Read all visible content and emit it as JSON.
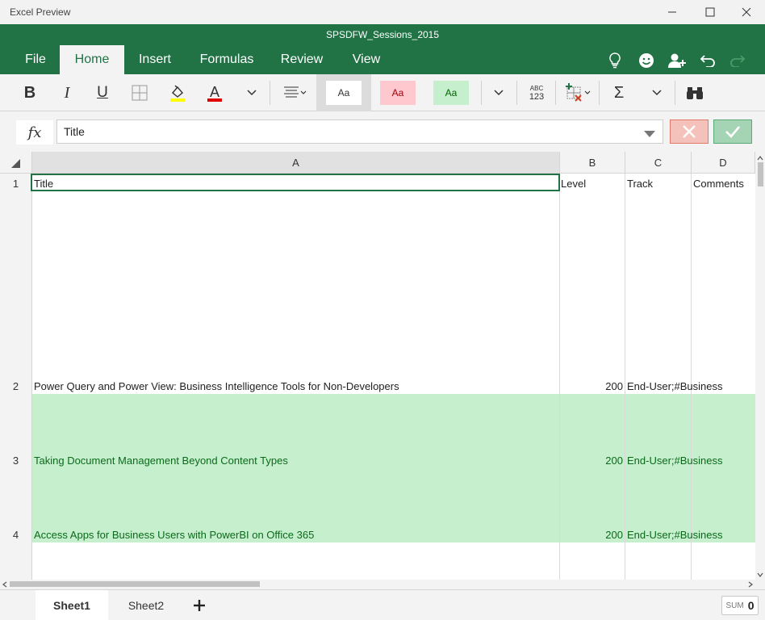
{
  "window": {
    "app_title": "Excel Preview"
  },
  "document": {
    "title": "SPSDFW_Sessions_2015"
  },
  "tabs": [
    "File",
    "Home",
    "Insert",
    "Formulas",
    "Review",
    "View"
  ],
  "toolbar": {
    "style_normal": "Aa",
    "style_bad": "Aa",
    "style_good": "Aa",
    "number_format_top": "ABC",
    "number_format_bottom": "123",
    "sum_symbol": "Σ"
  },
  "formula_bar": {
    "fx_label": "fx",
    "value": "Title"
  },
  "columns": [
    "A",
    "B",
    "C",
    "D"
  ],
  "rows": [
    {
      "num": "1",
      "a": "Title",
      "b": "Level",
      "c": "Track",
      "d": "Comments"
    },
    {
      "num": "2",
      "a": "Power Query and Power View: Business Intelligence Tools for Non-Developers",
      "b": "200",
      "c": "End-User;#Business",
      "d": ""
    },
    {
      "num": "3",
      "a": "Taking Document Management Beyond Content Types",
      "b": "200",
      "c": "End-User;#Business",
      "d": ""
    },
    {
      "num": "4",
      "a": "Access Apps for Business Users with PowerBI on Office 365",
      "b": "200",
      "c": "End-User;#Business",
      "d": ""
    }
  ],
  "sheets": [
    "Sheet1",
    "Sheet2"
  ],
  "add_sheet": "+",
  "status": {
    "sum_label": "SUM",
    "sum_value": "0"
  },
  "colors": {
    "accent": "#217346",
    "good_fill": "#c6efce",
    "good_text": "#006100",
    "bad_fill": "#ffc7ce"
  }
}
